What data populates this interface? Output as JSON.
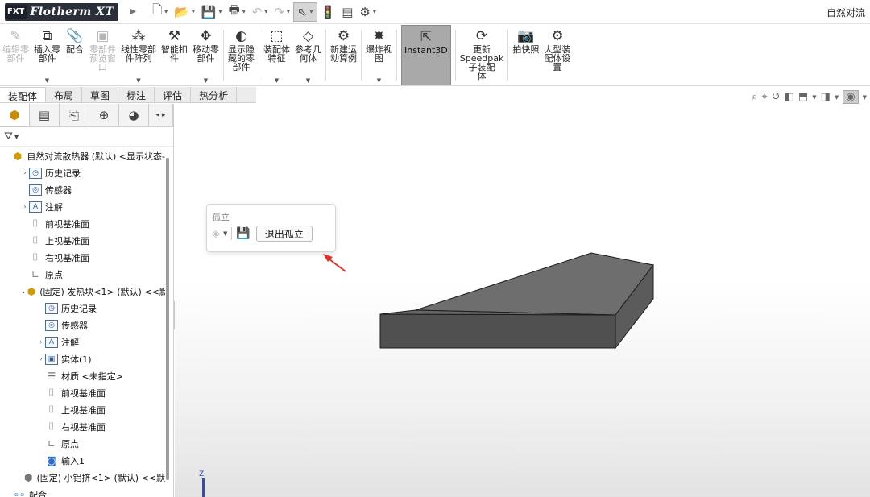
{
  "app": {
    "badge": "FXT",
    "name": "Flotherm XT",
    "document_title": "自然对流"
  },
  "quick_access": [
    {
      "name": "new-doc-icon",
      "glyph": "🗋",
      "dim": false,
      "active": false
    },
    {
      "name": "open-icon",
      "glyph": "📂",
      "dim": false,
      "active": false
    },
    {
      "name": "save-icon",
      "glyph": "💾",
      "dim": false,
      "active": false
    },
    {
      "name": "print-icon",
      "glyph": "🖶",
      "dim": false,
      "active": false
    },
    {
      "name": "undo-icon",
      "glyph": "↶",
      "dim": true,
      "active": false
    },
    {
      "name": "redo-icon",
      "glyph": "↷",
      "dim": true,
      "active": false
    },
    {
      "name": "select-cursor-icon",
      "glyph": "⇖",
      "dim": false,
      "active": true
    },
    {
      "name": "traffic-light-icon",
      "glyph": "🚦",
      "dim": false,
      "active": false
    },
    {
      "name": "file-properties-icon",
      "glyph": "▤",
      "dim": false,
      "active": false
    },
    {
      "name": "options-gear-icon",
      "glyph": "⚙",
      "dim": false,
      "active": false
    }
  ],
  "ribbon": [
    {
      "name": "edit-component-button",
      "icon": "edit-component-icon",
      "glyph": "✎",
      "label": "编辑零\n部件",
      "dim": true,
      "dd": false,
      "sel": false,
      "sep_after": false
    },
    {
      "name": "insert-component-button",
      "icon": "insert-component-icon",
      "glyph": "⧉",
      "label": "插入零\n部件",
      "dim": false,
      "dd": true,
      "sel": false,
      "sep_after": false
    },
    {
      "name": "mate-button",
      "icon": "paperclip-icon",
      "glyph": "📎",
      "label": "配合",
      "dim": false,
      "dd": false,
      "sel": false,
      "sep_after": false
    },
    {
      "name": "component-preview-button",
      "icon": "preview-window-icon",
      "glyph": "▣",
      "label": "零部件\n预览窗\n口",
      "dim": true,
      "dd": false,
      "sel": false,
      "sep_after": false
    },
    {
      "name": "linear-pattern-button",
      "icon": "linear-pattern-icon",
      "glyph": "⁂",
      "label": "线性零部\n件阵列",
      "dim": false,
      "dd": true,
      "sel": false,
      "sep_after": false
    },
    {
      "name": "smart-fasteners-button",
      "icon": "smart-fasteners-icon",
      "glyph": "⚒",
      "label": "智能扣\n件",
      "dim": false,
      "dd": false,
      "sel": false,
      "sep_after": false
    },
    {
      "name": "move-component-button",
      "icon": "move-component-icon",
      "glyph": "✥",
      "label": "移动零\n部件",
      "dim": false,
      "dd": true,
      "sel": false,
      "sep_after": true
    },
    {
      "name": "show-hidden-button",
      "icon": "show-hidden-icon",
      "glyph": "◐",
      "label": "显示隐\n藏的零\n部件",
      "dim": false,
      "dd": false,
      "sel": false,
      "sep_after": true
    },
    {
      "name": "assembly-feature-button",
      "icon": "assembly-feature-icon",
      "glyph": "⬚",
      "label": "装配体\n特征",
      "dim": false,
      "dd": true,
      "sel": false,
      "sep_after": false
    },
    {
      "name": "reference-geometry-button",
      "icon": "reference-geometry-icon",
      "glyph": "◇",
      "label": "参考几\n何体",
      "dim": false,
      "dd": true,
      "sel": false,
      "sep_after": true
    },
    {
      "name": "new-motion-study-button",
      "icon": "motion-study-icon",
      "glyph": "⚙",
      "label": "新建运\n动算例",
      "dim": false,
      "dd": false,
      "sel": false,
      "sep_after": true
    },
    {
      "name": "exploded-view-button",
      "icon": "exploded-view-icon",
      "glyph": "✸",
      "label": "爆炸视\n图",
      "dim": false,
      "dd": true,
      "sel": false,
      "sep_after": true
    },
    {
      "name": "instant3d-button",
      "icon": "instant3d-icon",
      "glyph": "⇱",
      "label": "Instant3D",
      "dim": false,
      "dd": false,
      "sel": true,
      "sep_after": true
    },
    {
      "name": "update-speedpak-button",
      "icon": "speedpak-icon",
      "glyph": "⟳",
      "label": "更新\nSpeedpak\n子装配\n体",
      "dim": false,
      "dd": false,
      "sel": false,
      "sep_after": true
    },
    {
      "name": "take-snapshot-button",
      "icon": "camera-icon",
      "glyph": "📷",
      "label": "拍快照",
      "dim": false,
      "dd": false,
      "sel": false,
      "sep_after": false
    },
    {
      "name": "large-assembly-settings-button",
      "icon": "large-assembly-icon",
      "glyph": "⚙",
      "label": "大型装\n配体设\n置",
      "dim": false,
      "dd": false,
      "sel": false,
      "sep_after": false
    }
  ],
  "tabs": [
    "装配体",
    "布局",
    "草图",
    "标注",
    "评估",
    "热分析"
  ],
  "view_toolbar": [
    {
      "name": "zoom-to-fit-icon",
      "glyph": "⌕"
    },
    {
      "name": "zoom-area-icon",
      "glyph": "⌖"
    },
    {
      "name": "previous-view-icon",
      "glyph": "↺"
    },
    {
      "name": "section-view-icon",
      "glyph": "◧"
    },
    {
      "name": "view-orientation-icon",
      "glyph": "⬒"
    },
    {
      "name": "display-style-icon",
      "glyph": "◨"
    },
    {
      "name": "hide-show-items-icon",
      "glyph": "◉"
    }
  ],
  "panel_tabs": [
    {
      "name": "feature-manager-icon",
      "glyph": "⬢"
    },
    {
      "name": "property-manager-icon",
      "glyph": "▤"
    },
    {
      "name": "configuration-manager-icon",
      "glyph": "⎗"
    },
    {
      "name": "dimxpert-icon",
      "glyph": "⊕"
    },
    {
      "name": "display-manager-icon",
      "glyph": "◕"
    }
  ],
  "tree": [
    {
      "indent": 0,
      "exp": "",
      "icon": "assembly-icon",
      "glyph": "⬢",
      "cls": "gold",
      "label": "自然对流散热器 (默认) <显示状态-"
    },
    {
      "indent": 1,
      "exp": "›",
      "icon": "history-icon",
      "glyph": "◷",
      "cls": "box",
      "label": "历史记录"
    },
    {
      "indent": 1,
      "exp": "",
      "icon": "sensors-icon",
      "glyph": "◎",
      "cls": "box",
      "label": "传感器"
    },
    {
      "indent": 1,
      "exp": "›",
      "icon": "annotations-icon",
      "glyph": "A",
      "cls": "box",
      "label": "注解"
    },
    {
      "indent": 1,
      "exp": "",
      "icon": "plane-icon",
      "glyph": "⌷",
      "cls": "gray",
      "label": "前视基准面"
    },
    {
      "indent": 1,
      "exp": "",
      "icon": "plane-icon",
      "glyph": "⌷",
      "cls": "gray",
      "label": "上视基准面"
    },
    {
      "indent": 1,
      "exp": "",
      "icon": "plane-icon",
      "glyph": "⌷",
      "cls": "gray",
      "label": "右视基准面"
    },
    {
      "indent": 1,
      "exp": "",
      "icon": "origin-icon",
      "glyph": "∟",
      "cls": "gray",
      "label": "原点"
    },
    {
      "indent": 1,
      "exp": "⌄",
      "icon": "part-icon",
      "glyph": "⬢",
      "cls": "gold",
      "label": "(固定) 发热块<1> (默认) <<默"
    },
    {
      "indent": 2,
      "exp": "",
      "icon": "history-icon",
      "glyph": "◷",
      "cls": "box",
      "label": "历史记录"
    },
    {
      "indent": 2,
      "exp": "",
      "icon": "sensors-icon",
      "glyph": "◎",
      "cls": "box",
      "label": "传感器"
    },
    {
      "indent": 2,
      "exp": "›",
      "icon": "annotations-icon",
      "glyph": "A",
      "cls": "box",
      "label": "注解"
    },
    {
      "indent": 2,
      "exp": "›",
      "icon": "solid-bodies-icon",
      "glyph": "▣",
      "cls": "box",
      "label": "实体(1)"
    },
    {
      "indent": 2,
      "exp": "",
      "icon": "material-icon",
      "glyph": "☰",
      "cls": "gray",
      "label": "材质 <未指定>"
    },
    {
      "indent": 2,
      "exp": "",
      "icon": "plane-icon",
      "glyph": "⌷",
      "cls": "gray",
      "label": "前视基准面"
    },
    {
      "indent": 2,
      "exp": "",
      "icon": "plane-icon",
      "glyph": "⌷",
      "cls": "gray",
      "label": "上视基准面"
    },
    {
      "indent": 2,
      "exp": "",
      "icon": "plane-icon",
      "glyph": "⌷",
      "cls": "gray",
      "label": "右视基准面"
    },
    {
      "indent": 2,
      "exp": "",
      "icon": "origin-icon",
      "glyph": "∟",
      "cls": "gray",
      "label": "原点"
    },
    {
      "indent": 2,
      "exp": "",
      "icon": "import-body-icon",
      "glyph": "◙",
      "cls": "blue",
      "label": "输入1"
    },
    {
      "indent": 1,
      "exp": "",
      "icon": "part-icon",
      "glyph": "⬢",
      "cls": "gray",
      "label": "(固定) 小铝挤<1> (默认) <<默"
    },
    {
      "indent": 0,
      "exp": "",
      "icon": "mates-icon",
      "glyph": "⧟",
      "cls": "blue",
      "label": "配合"
    }
  ],
  "isolate_popup": {
    "title": "孤立",
    "exit_label": "退出孤立"
  },
  "triad_label": "Z",
  "colors": {
    "box_top": "#6e6e6e",
    "box_front": "#4f4f4f",
    "box_side": "#5d5d5d",
    "arrow": "#e8302a"
  }
}
